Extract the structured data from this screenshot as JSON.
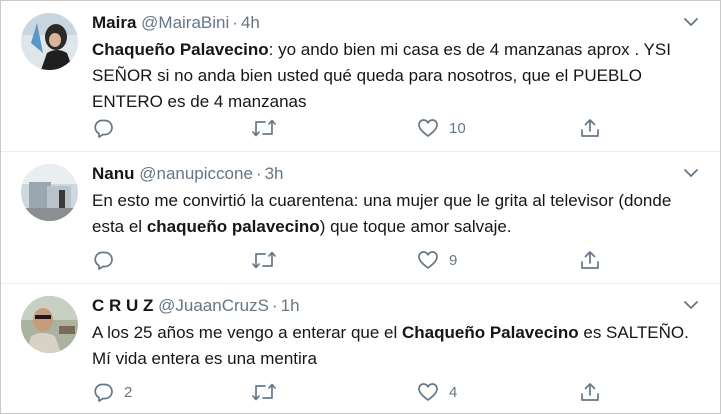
{
  "colors": {
    "name": "#14171a",
    "secondary": "#657786",
    "divider": "#e6ecf0"
  },
  "tweets": [
    {
      "name": "Maira",
      "handle": "@MairaBini",
      "separator": "·",
      "time": "4h",
      "body_parts": [
        {
          "text": "Chaqueño Palavecino",
          "bold": true
        },
        {
          "text": ": yo ando bien mi casa es de 4 manzanas aprox . YSI SEÑOR si no anda bien usted qué queda para nosotros, que el PUEBLO ENTERO es de 4 manzanas",
          "bold": false
        }
      ],
      "replies": "",
      "retweets": "",
      "likes": "10"
    },
    {
      "name": "Nanu",
      "handle": "@nanupiccone",
      "separator": "·",
      "time": "3h",
      "body_parts": [
        {
          "text": "En esto me convirtió la cuarentena: una mujer que le grita al televisor (donde esta el ",
          "bold": false
        },
        {
          "text": "chaqueño palavecino",
          "bold": true
        },
        {
          "text": ") que toque amor salvaje.",
          "bold": false
        }
      ],
      "replies": "",
      "retweets": "",
      "likes": "9"
    },
    {
      "name": "C R U Z",
      "handle": "@JuaanCruzS",
      "separator": "·",
      "time": "1h",
      "body_parts": [
        {
          "text": "A los 25 años me vengo a enterar que el ",
          "bold": false
        },
        {
          "text": "Chaqueño Palavecino",
          "bold": true
        },
        {
          "text": " es SALTEÑO. Mí vida entera es una mentira",
          "bold": false
        }
      ],
      "replies": "2",
      "retweets": "",
      "likes": "4"
    }
  ]
}
